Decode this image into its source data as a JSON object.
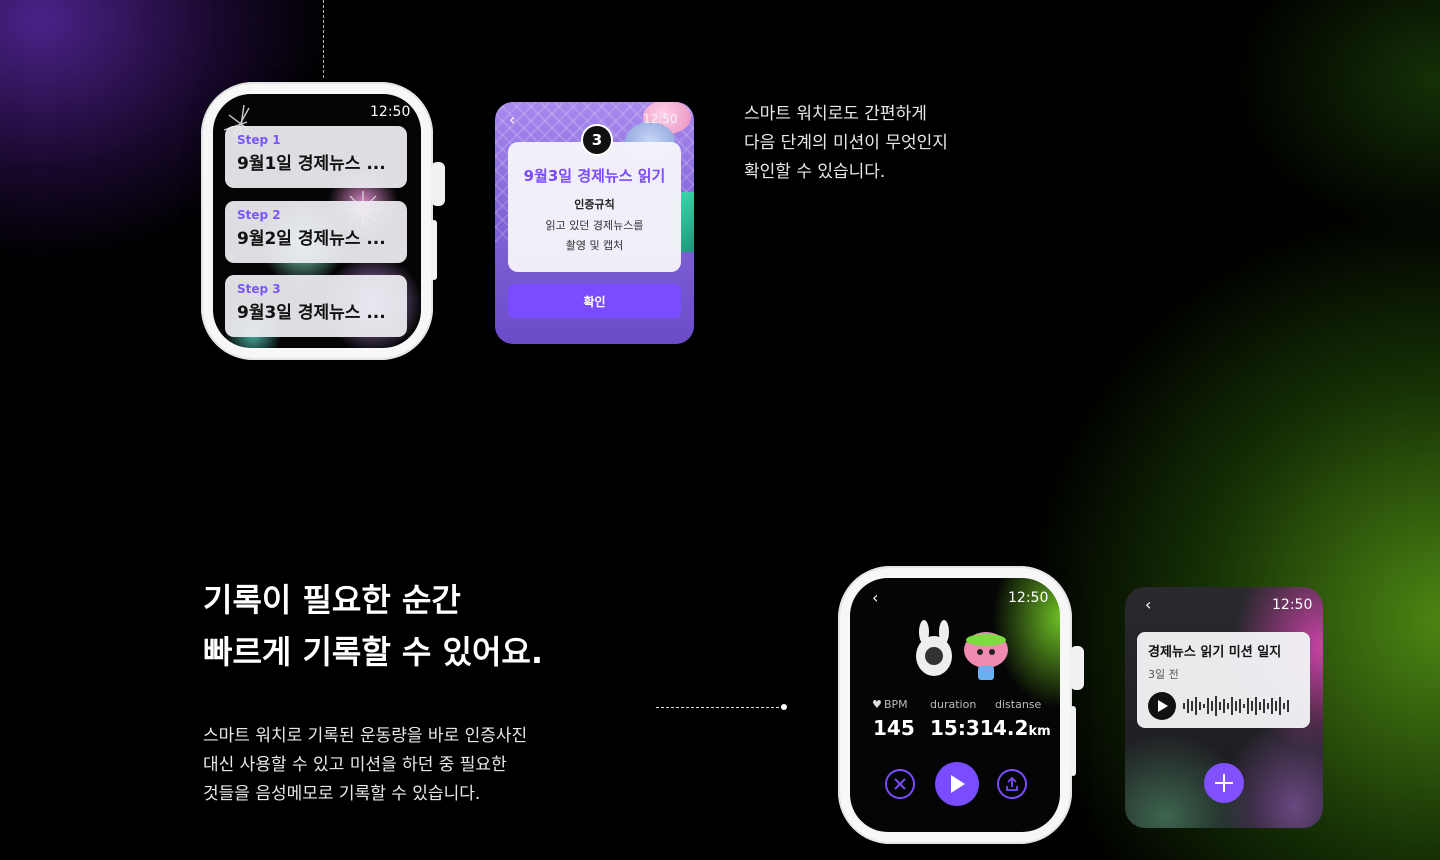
{
  "colors": {
    "accent": "#7a4cff",
    "background": "#000000",
    "green_glow": "#5a9a1a",
    "purple_glow": "#4a2490"
  },
  "watch1": {
    "time": "12:50",
    "steps": [
      {
        "label": "Step 1",
        "title": "9월1일 경제뉴스 ..."
      },
      {
        "label": "Step 2",
        "title": "9월2일 경제뉴스 ..."
      },
      {
        "label": "Step 3",
        "title": "9월3일 경제뉴스 ..."
      }
    ]
  },
  "screen2": {
    "back_icon": "chevron-left-icon",
    "time": "12:50",
    "badge": "3",
    "title": "9월3일 경제뉴스 읽기",
    "rule_heading": "인증규칙",
    "rule_line1": "읽고 있던 경제뉴스를",
    "rule_line2": "촬영 및 캡처",
    "confirm_label": "확인"
  },
  "section1": {
    "desc_lines": [
      "스마트 워치로도 간편하게",
      "다음 단계의 미션이 무엇인지",
      "확인할 수 있습니다."
    ]
  },
  "section2": {
    "heading_lines": [
      "기록이 필요한 순간",
      "빠르게 기록할 수 있어요."
    ],
    "desc_lines": [
      "스마트 워치로 기록된 운동량을 바로 인증사진",
      "대신 사용할 수 있고 미션을 하던 중 필요한",
      "것들을 음성메모로 기록할 수 있습니다."
    ]
  },
  "watch3": {
    "time": "12:50",
    "stats": [
      {
        "label": "BPM",
        "value": "145",
        "unit": ""
      },
      {
        "label": "duration",
        "value": "15:31",
        "unit": ""
      },
      {
        "label": "distanse",
        "value": "4.2",
        "unit": "km"
      }
    ],
    "controls": [
      "close-icon",
      "play-icon",
      "share-icon"
    ]
  },
  "screen4": {
    "time": "12:50",
    "memo_title": "경제뉴스 읽기 미션 일지",
    "memo_sub": "3일 전",
    "add_icon": "plus-icon"
  }
}
